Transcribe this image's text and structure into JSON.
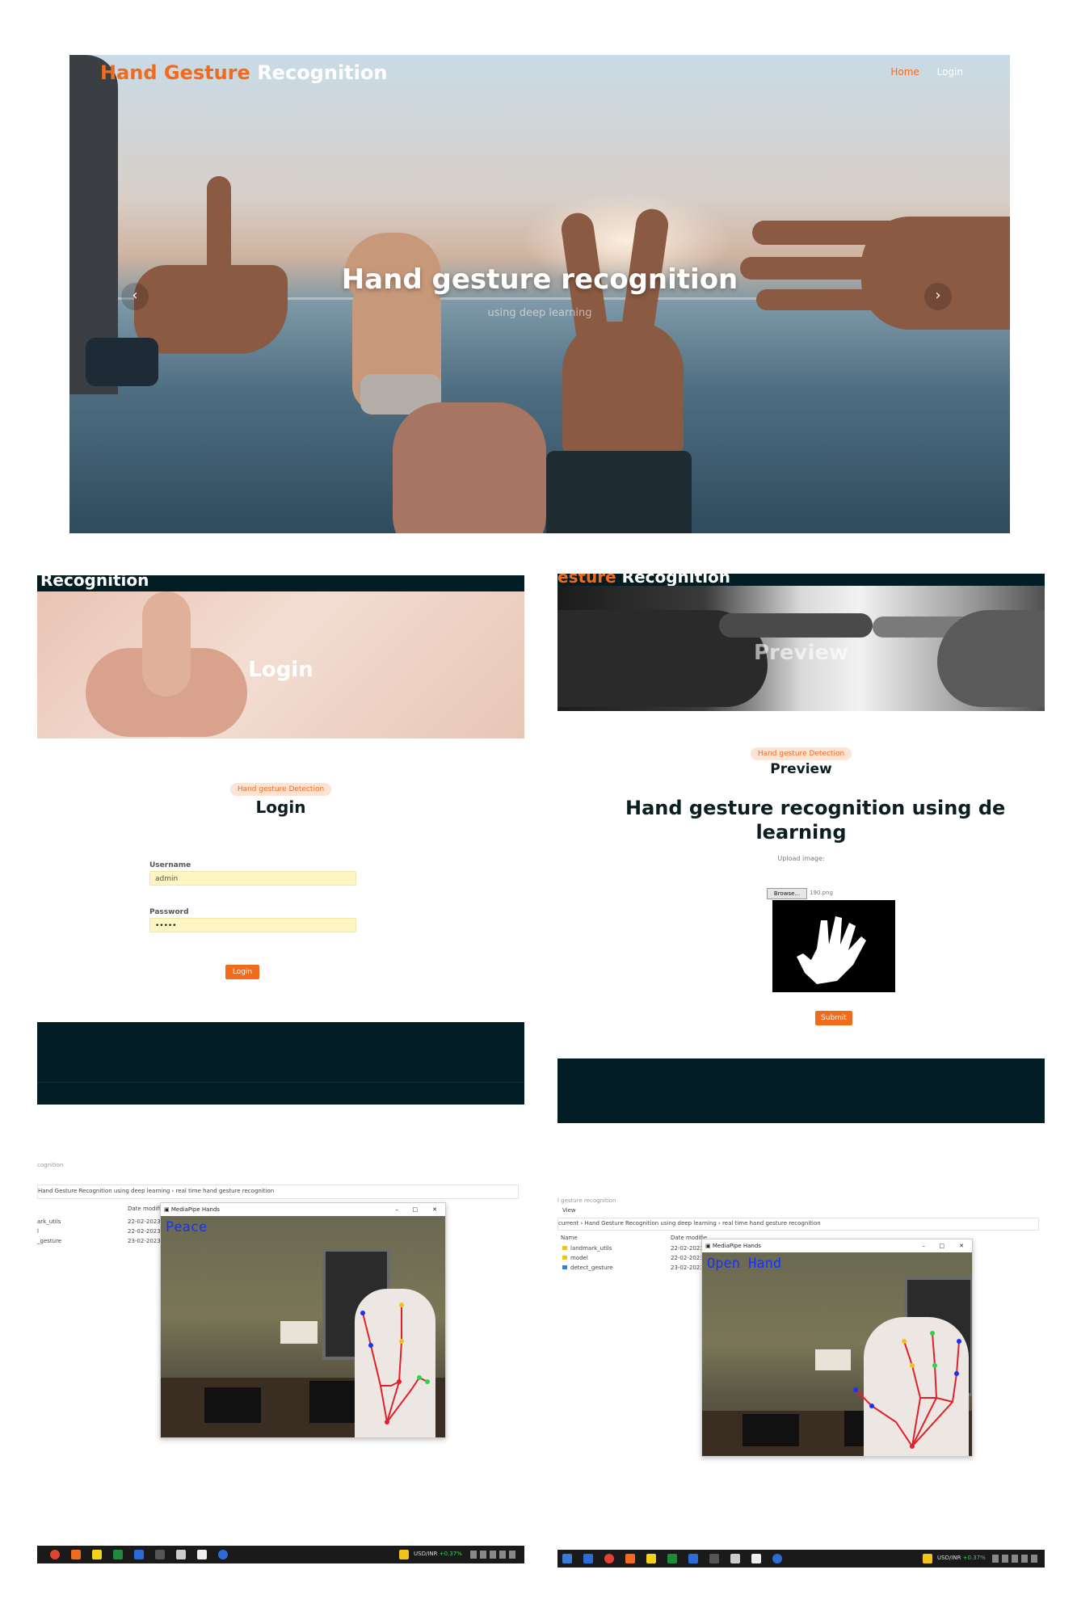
{
  "hero": {
    "brand_part1": "Hand Gesture",
    "brand_part2": "Recognition",
    "nav": [
      "Home",
      "Login"
    ],
    "title": "Hand gesture recognition",
    "subtitle": "using deep learning",
    "prev_arrow": "‹",
    "next_arrow": "›"
  },
  "login_page": {
    "header_text": "Recognition",
    "banner_title": "Login",
    "badge": "Hand gesture Detection",
    "heading": "Login",
    "username_label": "Username",
    "username_value": "admin",
    "password_label": "Password",
    "password_value": "•••••",
    "submit_label": "Login"
  },
  "preview_page": {
    "header_text_1": "esture",
    "header_text_2": "Recognition",
    "banner_title": "Preview",
    "badge": "Hand gesture Detection",
    "heading": "Preview",
    "title_line1": "Hand gesture recognition using de",
    "title_line2": "learning",
    "upload_label": "Upload image:",
    "browse_label": "Browse...",
    "file_name": "190.png",
    "submit_label": "Submit"
  },
  "screenshot_peace": {
    "window_caption": "cognition",
    "path": "Hand Gesture Recognition using deep learning  ›  real time hand gesture recognition",
    "column_date": "Date modifie",
    "files": [
      {
        "name": "ark_utils",
        "date": "22-02-2023"
      },
      {
        "name": "l",
        "date": "22-02-2023"
      },
      {
        "name": "_gesture",
        "date": "23-02-2023"
      }
    ],
    "cam_title": "MediaPipe Hands",
    "gesture": "Peace",
    "currency": "USD/INR",
    "currency_change": "+0.37%"
  },
  "screenshot_open": {
    "window_caption": "l gesture recognition",
    "menu": "View",
    "path": "current  ›  Hand Gesture Recognition using deep learning  ›  real time hand gesture recognition",
    "column_name": "Name",
    "column_date": "Date modifie",
    "files": [
      {
        "name": "landmark_utils",
        "date": "22-02-2023"
      },
      {
        "name": "model",
        "date": "22-02-2023"
      },
      {
        "name": "detect_gesture",
        "date": "23-02-2023"
      }
    ],
    "cam_title": "MediaPipe Hands",
    "gesture": "Open Hand",
    "currency": "USD/INR",
    "currency_change": "+0.37%"
  },
  "colors": {
    "accent": "#f26b1d",
    "dark_footer": "#021e24",
    "gesture_text": "#1a2fff"
  },
  "icons": [
    "chevron-left-icon",
    "chevron-right-icon",
    "folder-icon",
    "python-file-icon",
    "minimize-icon",
    "maximize-icon",
    "close-icon",
    "chrome-icon",
    "taskbar-app-icon",
    "weather-icon"
  ]
}
